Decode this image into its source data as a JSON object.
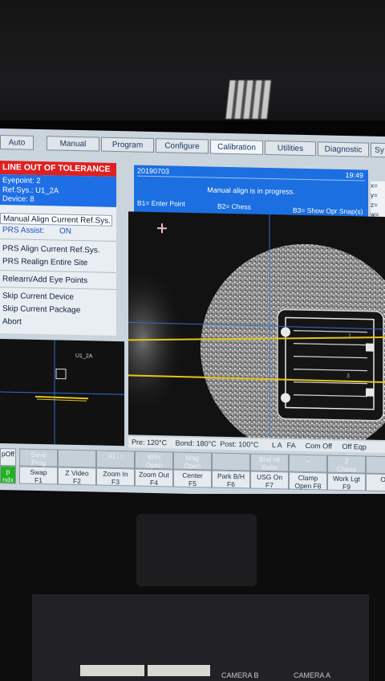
{
  "tabs": [
    "Auto",
    "Manual",
    "Program",
    "Configure",
    "Calibration",
    "Utilities",
    "Diagnostic",
    "Sy"
  ],
  "alert": "LINE OUT OF TOLERANCE",
  "info": {
    "eyepoint": "Eyepoint: 2",
    "refsys": "Ref.Sys.: U1_2A",
    "device": "Device: 8"
  },
  "menu": {
    "manual_align": "Manual Align Current Ref.Sys.",
    "prs_assist_label": "PRS Assist:",
    "prs_assist_value": "ON",
    "prs_align": "PRS Align Current Ref.Sys.",
    "prs_realign": "PRS Realign Entire Site",
    "relearn": "Relearn/Add Eye Points",
    "skip_device": "Skip Current Device",
    "skip_package": "Skip Current Package",
    "abort": "Abort"
  },
  "minicam_label": "U1_2A",
  "status": {
    "date": "20190703",
    "time": "19:49",
    "message": "Manual align is in progress.",
    "b1": "B1= Enter Point",
    "b2": "B2= Chess",
    "b3": "B3= Show Opr Snap(s)"
  },
  "coords": {
    "x": "x=",
    "y": "y=",
    "z": "z=",
    "w": "w="
  },
  "temps": {
    "pre": "Pre: 120°C",
    "bond": "Bond: 180°C",
    "post": "Post: 100°C",
    "la": "L A",
    "fa": "FA",
    "com": "Com Off",
    "eqp": "Off Eqp"
  },
  "camera_markers": [
    "1",
    "3"
  ],
  "fkeys": [
    {
      "top": "pOff",
      "bot": "p\nndx"
    },
    {
      "top": "Save\nProg",
      "bot": "Swap\nF1"
    },
    {
      "top": "",
      "bot": "Z Video\nF2"
    },
    {
      "top": "Al.↓↑",
      "bot": "Zoom In\nF3"
    },
    {
      "top": "W/H\nOpen",
      "bot": "Zoom Out\nF4"
    },
    {
      "top": "Mag\nOpen",
      "bot": "Center\nF5"
    },
    {
      "top": "",
      "bot": "Park B/H\nF6"
    },
    {
      "top": "Bnd Ht\nRelm",
      "bot": "USG On\nF7"
    },
    {
      "top": "↔",
      "bot": "Clamp\nOpen F8"
    },
    {
      "top": "2\nChess",
      "bot": "Work Lgt\nF9"
    },
    {
      "top": "",
      "bot": "Op"
    }
  ],
  "hardware": {
    "camera_b": "CAMERA B",
    "camera_a": "CAMERA A"
  }
}
